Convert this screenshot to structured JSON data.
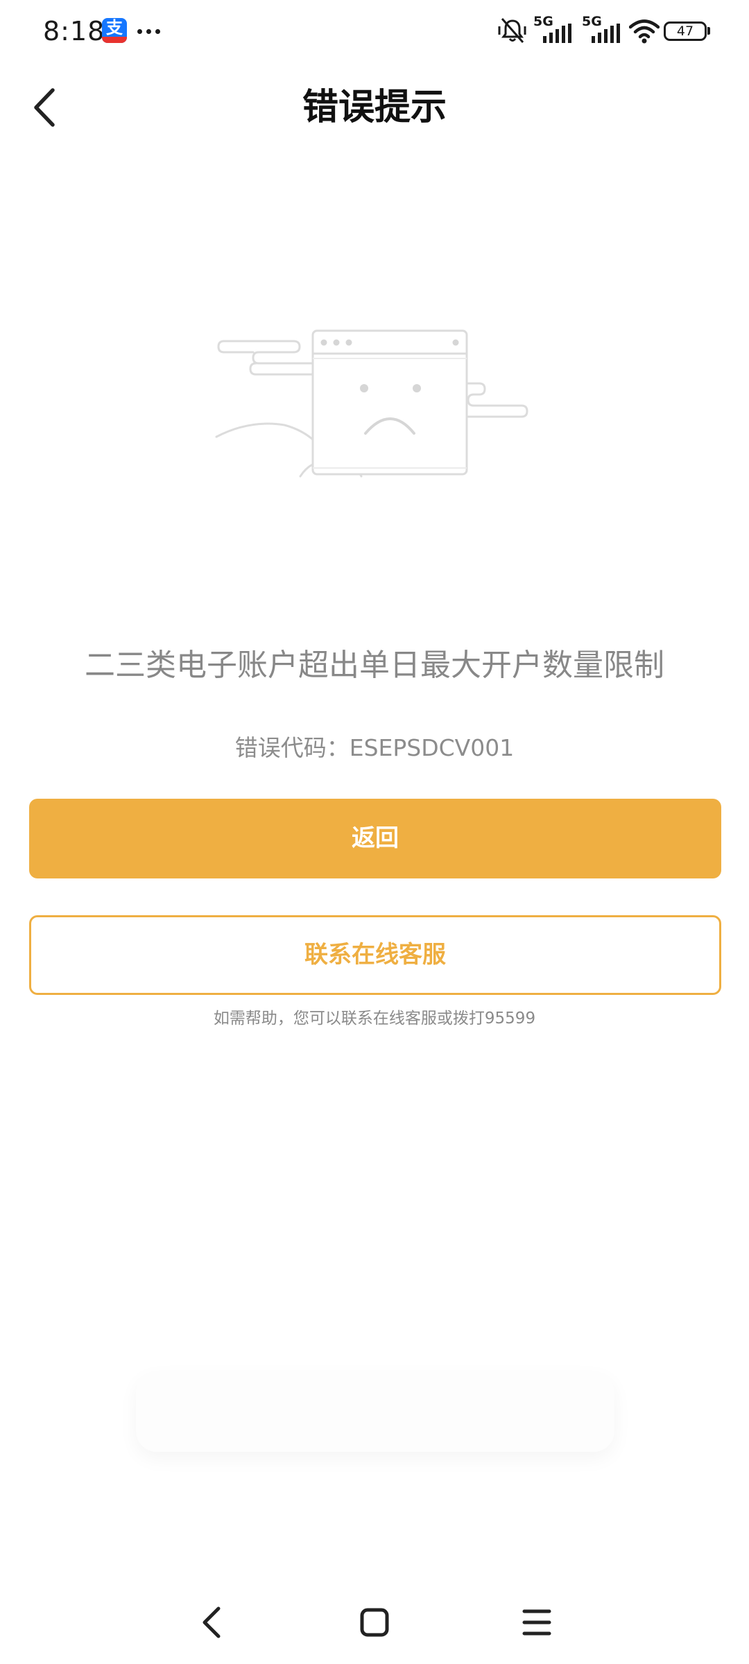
{
  "status_bar": {
    "time": "8:18",
    "app_icon": "alipay-icon",
    "app_icon_glyph": "支",
    "more_icon": "more-dots-icon",
    "network_label_1": "5G",
    "network_label_2": "5G",
    "battery": "47"
  },
  "header": {
    "title": "错误提示",
    "back_icon": "chevron-left-icon"
  },
  "illustration": {
    "icon": "sad-browser-window-illustration"
  },
  "content": {
    "message": "二三类电子账户超出单日最大开户数量限制",
    "error_code": "错误代码：ESEPSDCV001",
    "help_text": "如需帮助，您可以联系在线客服或拨打95599"
  },
  "buttons": {
    "back_label": "返回",
    "contact_label": "联系在线客服"
  },
  "colors": {
    "accent": "#efaf42",
    "message_gray": "#888888",
    "title": "#111111"
  },
  "nav_bar": {
    "back_icon": "nav-back-icon",
    "home_icon": "nav-home-icon",
    "menu_icon": "nav-menu-icon"
  }
}
